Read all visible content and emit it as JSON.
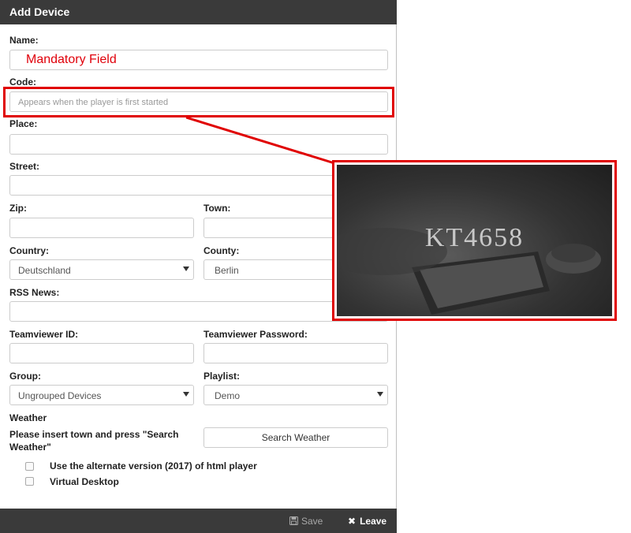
{
  "dialog": {
    "title": "Add Device",
    "fields": {
      "name": {
        "label": "Name:",
        "value": "Mandatory Field"
      },
      "code": {
        "label": "Code:",
        "placeholder": "Appears when the player is first started"
      },
      "place": {
        "label": "Place:",
        "value": ""
      },
      "street": {
        "label": "Street:",
        "value": ""
      },
      "zip": {
        "label": "Zip:",
        "value": ""
      },
      "town": {
        "label": "Town:",
        "value": ""
      },
      "country": {
        "label": "Country:",
        "value": "Deutschland"
      },
      "county": {
        "label": "County:",
        "value": "Berlin"
      },
      "rss": {
        "label": "RSS News:",
        "value": ""
      },
      "teamviewer_id": {
        "label": "Teamviewer ID:",
        "value": ""
      },
      "teamviewer_password": {
        "label": "Teamviewer Password:",
        "value": ""
      },
      "group": {
        "label": "Group:",
        "value": "Ungrouped Devices"
      },
      "playlist": {
        "label": "Playlist:",
        "value": "Demo"
      }
    },
    "weather": {
      "heading": "Weather",
      "hint": "Please insert town and press \"Search Weather\"",
      "button": "Search Weather"
    },
    "checkboxes": {
      "alternate": "Use the alternate version (2017) of html player",
      "virtual_desktop": "Virtual Desktop"
    },
    "footer": {
      "save": "Save",
      "leave": "Leave"
    }
  },
  "callout": {
    "code_text": "KT4658"
  },
  "colors": {
    "titlebar": "#3a3a3a",
    "highlight": "#e00000",
    "mandatory_text": "#e0000a"
  }
}
